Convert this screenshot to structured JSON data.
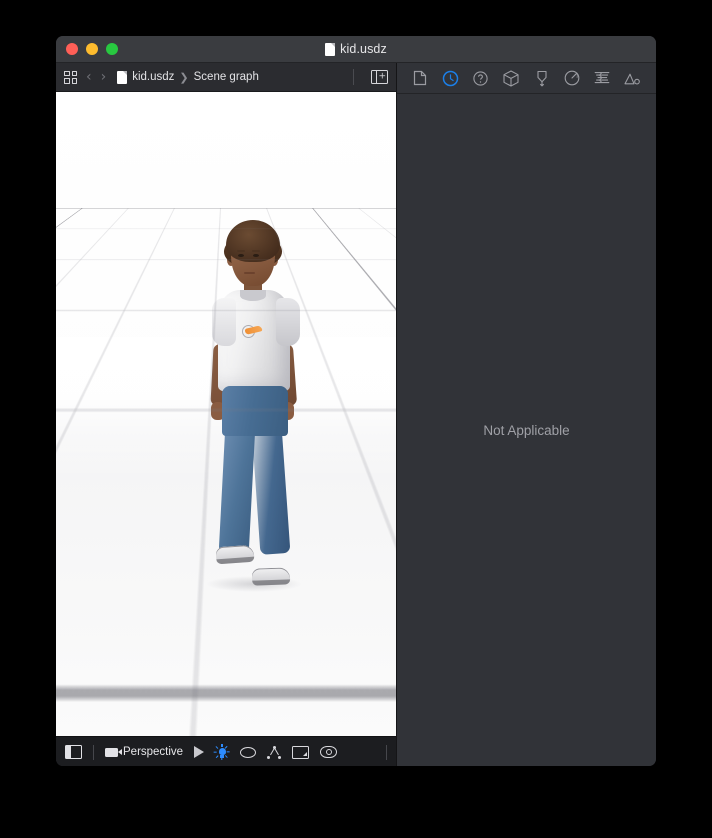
{
  "window": {
    "title": "kid.usdz",
    "title_icon": "document-icon",
    "traffic_lights": {
      "close": "#ff5f57",
      "minimize": "#febc2e",
      "zoom": "#28c840"
    }
  },
  "breadcrumb_bar": {
    "grid_button": "grid-view-icon",
    "back_chevron": "‹",
    "forward_chevron": "›",
    "file_icon": "document-icon",
    "path": [
      "kid.usdz",
      "Scene graph"
    ],
    "separator": "❯",
    "add_panel_button": "add-panel-icon"
  },
  "viewport": {
    "scene": "3d-character-kid",
    "background": "#ffffff",
    "grid_color": "#78788250",
    "model": {
      "name": "kid",
      "shirt_color": "#f0f0f1",
      "jeans_color": "#476d93",
      "skin_color": "#8b5e42",
      "hair_color": "#4a3120",
      "shoe_color": "#e4e4e6",
      "logo_color": "#f08a2a"
    }
  },
  "viewport_toolbar": {
    "sidebar_toggle": "sidebar-toggle-icon",
    "camera_icon": "camera-icon",
    "camera_label": "Perspective",
    "play_button": "play-icon",
    "light_button": "lightbulb-icon",
    "light_active": true,
    "orbit_button": "orbit-icon",
    "rig_button": "skeleton-rig-icon",
    "bounds_button": "bounding-box-icon",
    "visibility_button": "eye-icon",
    "accent_color": "#2d8cff"
  },
  "inspector": {
    "active_tab_index": 1,
    "accent_color": "#1b7fe8",
    "tabs": [
      {
        "name": "file-inspector",
        "icon": "document-icon"
      },
      {
        "name": "metadata-inspector",
        "icon": "clock-icon"
      },
      {
        "name": "help-inspector",
        "icon": "question-circle-icon"
      },
      {
        "name": "geometry-inspector",
        "icon": "cube-icon"
      },
      {
        "name": "anchor-inspector",
        "icon": "pin-icon"
      },
      {
        "name": "material-inspector",
        "icon": "material-sphere-icon"
      },
      {
        "name": "animation-inspector",
        "icon": "animation-waves-icon"
      },
      {
        "name": "statistics-inspector",
        "icon": "mountain-triangle-icon"
      }
    ],
    "empty_state": "Not Applicable"
  }
}
